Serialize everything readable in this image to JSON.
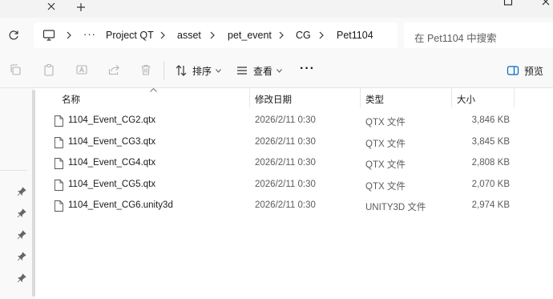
{
  "window": {
    "title_icons": [
      "close-icon",
      "add-tab-icon",
      "maximize-icon",
      "close-window-icon"
    ]
  },
  "address": {
    "more": "···",
    "crumbs": [
      "Project QT",
      "asset",
      "pet_event",
      "CG",
      "Pet1104"
    ],
    "search_placeholder": "在 Pet1104 中搜索"
  },
  "toolbar": {
    "sort_label": "排序",
    "view_label": "查看",
    "more_label": "···",
    "preview_label": "预览"
  },
  "columns": {
    "name": "名称",
    "modified": "修改日期",
    "type": "类型",
    "size": "大小"
  },
  "files": [
    {
      "name": "1104_Event_CG2.qtx",
      "modified": "2026/2/11 0:30",
      "type": "QTX 文件",
      "size": "3,846 KB"
    },
    {
      "name": "1104_Event_CG3.qtx",
      "modified": "2026/2/11 0:30",
      "type": "QTX 文件",
      "size": "3,845 KB"
    },
    {
      "name": "1104_Event_CG4.qtx",
      "modified": "2026/2/11 0:30",
      "type": "QTX 文件",
      "size": "2,808 KB"
    },
    {
      "name": "1104_Event_CG5.qtx",
      "modified": "2026/2/11 0:30",
      "type": "QTX 文件",
      "size": "2,070 KB"
    },
    {
      "name": "1104_Event_CG6.unity3d",
      "modified": "2026/2/11 0:30",
      "type": "UNITY3D 文件",
      "size": "2,974 KB"
    }
  ],
  "colors": {
    "chrome_bg": "#f9f9f9",
    "titlebar_bg": "#f3f3f3",
    "accent": "#0067c0"
  }
}
